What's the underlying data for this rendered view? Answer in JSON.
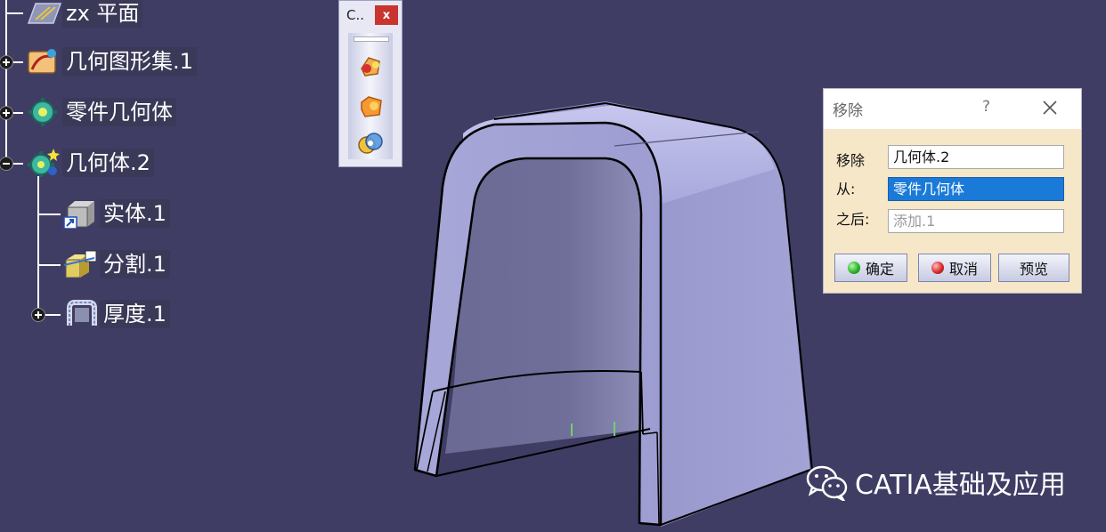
{
  "tree": {
    "items": [
      {
        "label": "zx 平面",
        "icon": "plane-icon"
      },
      {
        "label": "几何图形集.1",
        "icon": "geometrical-set-icon"
      },
      {
        "label": "零件几何体",
        "icon": "part-body-icon"
      },
      {
        "label": "几何体.2",
        "icon": "body-icon"
      },
      {
        "label": "实体.1",
        "icon": "solid-icon"
      },
      {
        "label": "分割.1",
        "icon": "split-icon"
      },
      {
        "label": "厚度.1",
        "icon": "thickness-icon"
      }
    ]
  },
  "mini_toolbar": {
    "title": "C..",
    "close": "x",
    "buttons": [
      "assemble-icon",
      "add-icon",
      "remove-icon"
    ]
  },
  "dialog": {
    "title": "移除",
    "help": "?",
    "rows": [
      {
        "label": "移除",
        "value": "几何体.2"
      },
      {
        "label": "从:",
        "value": "零件几何体"
      },
      {
        "label": "之后:",
        "value": "添加.1"
      }
    ],
    "buttons": {
      "ok": "确定",
      "cancel": "取消",
      "preview": "预览"
    },
    "colors": {
      "ok_dot": "#2bb52b",
      "cancel_dot": "#d92a2a",
      "selected": "#1a7ad8"
    }
  },
  "watermark": {
    "text": "CATIA基础及应用",
    "icon": "wechat-icon"
  },
  "colors": {
    "background": "#3f3d64",
    "part": "#a9a9d9"
  }
}
